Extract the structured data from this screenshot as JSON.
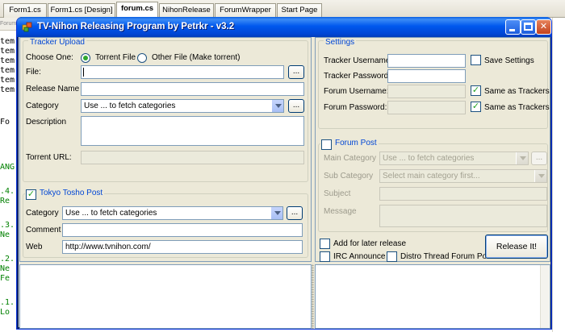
{
  "ide": {
    "tabs": [
      "Form1.cs",
      "Form1.cs [Design]",
      "forum.cs",
      "NihonRelease",
      "ForumWrapper",
      "Start Page"
    ],
    "active_tab": "forum.cs",
    "nav_dropdown": "Forumw",
    "code_lines": [
      {
        "text": "tem",
        "color": "black"
      },
      {
        "text": "tem",
        "color": "black"
      },
      {
        "text": "tem",
        "color": "black"
      },
      {
        "text": "tem",
        "color": "black"
      },
      {
        "text": "tem",
        "color": "black"
      },
      {
        "text": "tem",
        "color": "black"
      },
      {
        "text": "Fo",
        "color": "black"
      },
      {
        "text": "ANG",
        "color": "green"
      },
      {
        "text": ".4.",
        "color": "green"
      },
      {
        "text": " Re",
        "color": "green"
      },
      {
        "text": ".3.",
        "color": "green"
      },
      {
        "text": " Ne",
        "color": "green"
      },
      {
        "text": ".2.",
        "color": "green"
      },
      {
        "text": " Ne",
        "color": "green"
      },
      {
        "text": " Fe",
        "color": "green"
      },
      {
        "text": ".1.",
        "color": "green"
      },
      {
        "text": " Lo",
        "color": "green"
      }
    ]
  },
  "window": {
    "title": "TV-Nihon Releasing Program by Petrkr - v3.2",
    "title_color": "#0054e3",
    "close_symbol": "✕"
  },
  "tracker_upload": {
    "title": "Tracker Upload",
    "choose_label": "Choose One:",
    "radio_torrent": "Torrent File",
    "radio_other": "Other File (Make torrent)",
    "file_label": "File:",
    "file_value": "",
    "browse_label": "...",
    "release_name_label": "Release Name",
    "release_name_value": "",
    "category_label": "Category",
    "category_value": "Use ... to fetch categories",
    "category_browse": "...",
    "description_label": "Description",
    "torrent_url_label": "Torrent URL:",
    "torrent_url_value": ""
  },
  "tokyo_tosho": {
    "title": "Tokyo Tosho Post",
    "checked": true,
    "category_label": "Category",
    "category_value": "Use ... to fetch categories",
    "category_browse": "...",
    "comment_label": "Comment",
    "comment_value": "",
    "web_label": "Web",
    "web_value": "http://www.tvnihon.com/"
  },
  "settings": {
    "title": "Settings",
    "tracker_username_label": "Tracker Username:",
    "tracker_username_value": "",
    "tracker_password_label": "Tracker Password:",
    "tracker_password_value": "",
    "forum_username_label": "Forum Username:",
    "forum_username_value": "",
    "forum_password_label": "Forum Password:",
    "forum_password_value": "",
    "save_settings_label": "Save Settings",
    "same_as_trackers_1": "Same as Trackers",
    "same_as_trackers_2": "Same as Trackers"
  },
  "forum_post": {
    "title": "Forum Post",
    "checked": false,
    "main_category_label": "Main Category",
    "main_category_value": "Use ... to fetch categories",
    "main_category_browse": "...",
    "sub_category_label": "Sub Category",
    "sub_category_value": "Select main category first...",
    "subject_label": "Subject",
    "subject_value": "",
    "message_label": "Message"
  },
  "bottom_options": {
    "add_later_label": "Add for later release",
    "irc_label": "IRC Announce",
    "distro_label": "Distro Thread Forum Post",
    "release_button": "Release It!",
    "check_mark": "✓"
  }
}
